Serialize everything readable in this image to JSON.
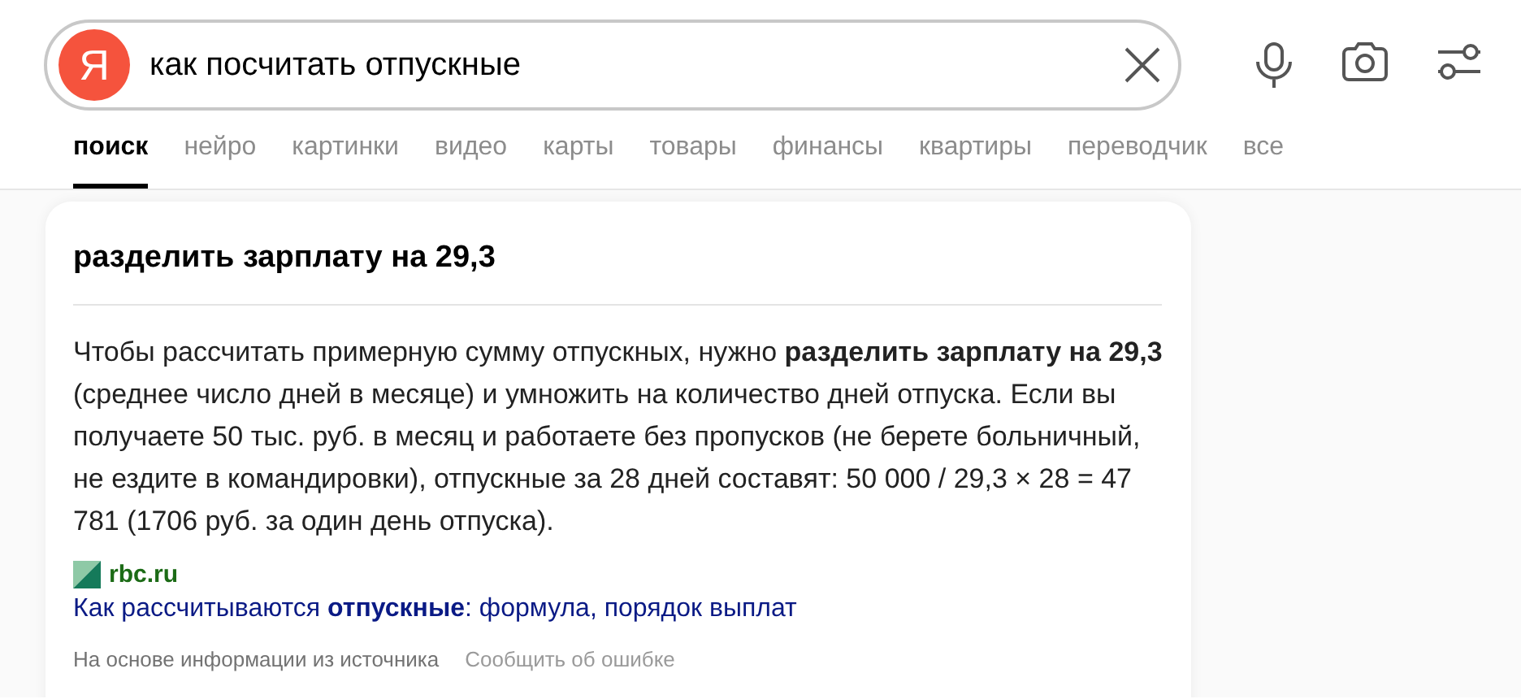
{
  "search": {
    "logo": "Я",
    "query": "как посчитать отпускные"
  },
  "tabs": [
    {
      "label": "поиск",
      "selected": true
    },
    {
      "label": "нейро",
      "selected": false
    },
    {
      "label": "картинки",
      "selected": false
    },
    {
      "label": "видео",
      "selected": false
    },
    {
      "label": "карты",
      "selected": false
    },
    {
      "label": "товары",
      "selected": false
    },
    {
      "label": "финансы",
      "selected": false
    },
    {
      "label": "квартиры",
      "selected": false
    },
    {
      "label": "переводчик",
      "selected": false
    },
    {
      "label": "все",
      "selected": false
    }
  ],
  "answer": {
    "title": "разделить зарплату на 29,3",
    "text": "Чтобы рассчитать примерную сумму отпускных, нужно **разделить зарплату на 29,3** (среднее число дней в месяце) и умножить на количество дней отпуска. Если вы получаете 50 тыс. руб. в месяц и работаете без пропусков (не берете больничный, не ездите в командировки), отпускные за 28 дней составят: 50 000 / 29,3 × 28 = 47 781 (1706 руб. за один день отпуска).",
    "source": "rbc.ru",
    "link": "Как рассчитываются **отпускные**: формула, порядок выплат",
    "note": "На основе информации из источника",
    "report": "Сообщить об ошибке"
  }
}
